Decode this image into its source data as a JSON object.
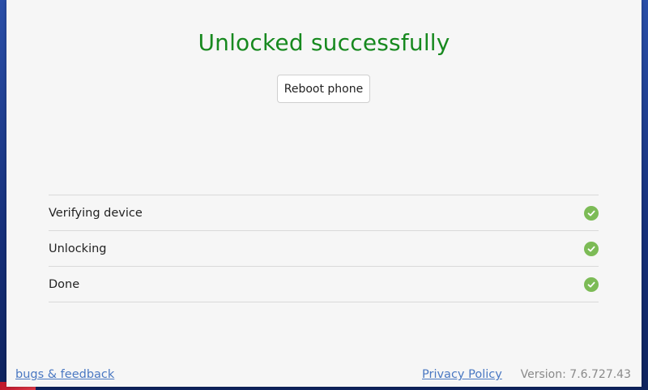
{
  "main": {
    "title": "Unlocked successfully",
    "reboot_label": "Reboot phone"
  },
  "steps": [
    {
      "label": "Verifying device",
      "status": "done"
    },
    {
      "label": "Unlocking",
      "status": "done"
    },
    {
      "label": "Done",
      "status": "done"
    }
  ],
  "footer": {
    "bugs_label": "bugs & feedback",
    "privacy_label": "Privacy Policy",
    "version": "Version: 7.6.727.43"
  },
  "colors": {
    "title": "#17891f",
    "check": "#7cbb56",
    "link": "#4a78c2"
  },
  "icons": {
    "check": "check-circle-icon"
  }
}
